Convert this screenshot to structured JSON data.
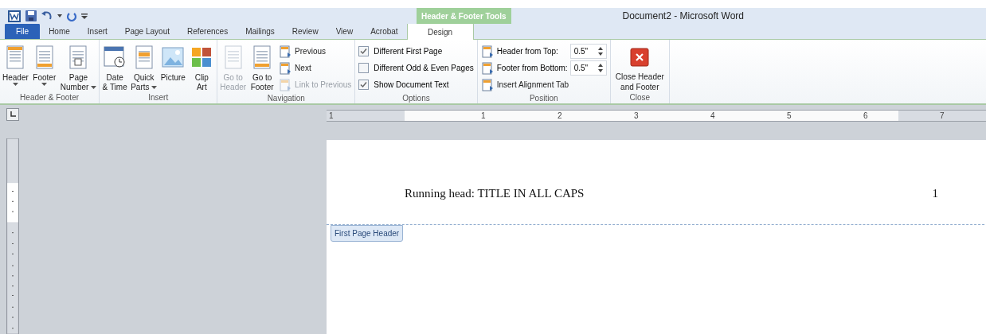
{
  "context_tab_group": "Header & Footer Tools",
  "window_title": "Document2 - Microsoft Word",
  "tabs": [
    {
      "label": "File",
      "kind": "file",
      "selected": false
    },
    {
      "label": "Home",
      "kind": "tab",
      "selected": false
    },
    {
      "label": "Insert",
      "kind": "tab",
      "selected": false
    },
    {
      "label": "Page Layout",
      "kind": "tab",
      "selected": false
    },
    {
      "label": "References",
      "kind": "tab",
      "selected": false
    },
    {
      "label": "Mailings",
      "kind": "tab",
      "selected": false
    },
    {
      "label": "Review",
      "kind": "tab",
      "selected": false
    },
    {
      "label": "View",
      "kind": "tab",
      "selected": false
    },
    {
      "label": "Acrobat",
      "kind": "tab",
      "selected": false
    },
    {
      "label": "Design",
      "kind": "tab",
      "selected": true
    }
  ],
  "ribbon_groups": [
    {
      "label": "Header & Footer",
      "items": [
        {
          "kind": "large",
          "lines": [
            "Header"
          ],
          "dropdown": true,
          "disabled": false
        },
        {
          "kind": "large",
          "lines": [
            "Footer"
          ],
          "dropdown": true,
          "disabled": false
        },
        {
          "kind": "large",
          "lines": [
            "Page",
            "Number"
          ],
          "dropdown": true,
          "disabled": false
        }
      ]
    },
    {
      "label": "Insert",
      "items": [
        {
          "kind": "large",
          "lines": [
            "Date",
            "& Time"
          ],
          "dropdown": false,
          "disabled": false
        },
        {
          "kind": "large",
          "lines": [
            "Quick",
            "Parts"
          ],
          "dropdown": true,
          "disabled": false
        },
        {
          "kind": "large",
          "lines": [
            "Picture"
          ],
          "dropdown": false,
          "disabled": false
        },
        {
          "kind": "large",
          "lines": [
            "Clip",
            "Art"
          ],
          "dropdown": false,
          "disabled": false
        }
      ]
    },
    {
      "label": "Navigation",
      "items": [
        {
          "kind": "large",
          "lines": [
            "Go to",
            "Header"
          ],
          "dropdown": false,
          "disabled": true
        },
        {
          "kind": "large",
          "lines": [
            "Go to",
            "Footer"
          ],
          "dropdown": false,
          "disabled": false
        },
        {
          "kind": "small",
          "label": "Previous",
          "disabled": false
        },
        {
          "kind": "small",
          "label": "Next",
          "disabled": false
        },
        {
          "kind": "small",
          "label": "Link to Previous",
          "disabled": true
        }
      ]
    },
    {
      "label": "Options",
      "items": [
        {
          "kind": "checkbox",
          "label": "Different First Page",
          "checked": true
        },
        {
          "kind": "checkbox",
          "label": "Different Odd & Even Pages",
          "checked": false
        },
        {
          "kind": "checkbox",
          "label": "Show Document Text",
          "checked": true
        }
      ]
    },
    {
      "label": "Position",
      "items": [
        {
          "kind": "spinner",
          "label": "Header from Top:",
          "value": "0.5\""
        },
        {
          "kind": "spinner",
          "label": "Footer from Bottom:",
          "value": "0.5\""
        },
        {
          "kind": "small",
          "label": "Insert Alignment Tab",
          "disabled": false
        }
      ]
    },
    {
      "label": "Close",
      "items": [
        {
          "kind": "close",
          "lines": [
            "Close Header",
            "and Footer"
          ]
        }
      ]
    }
  ],
  "ruler_labels": [
    "1",
    "1",
    "2",
    "3",
    "4",
    "5",
    "6",
    "7"
  ],
  "document": {
    "header_text": "Running head: TITLE IN ALL CAPS",
    "page_number": "1",
    "header_tag": "First Page Header"
  }
}
